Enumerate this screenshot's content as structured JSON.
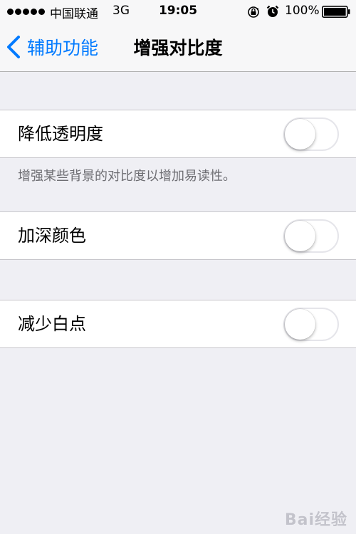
{
  "status_bar": {
    "carrier": "中国联通",
    "network": "3G",
    "time": "19:05",
    "battery_percent": "100%"
  },
  "nav": {
    "back_label": "辅助功能",
    "title": "增强对比度"
  },
  "settings": [
    {
      "label": "降低透明度",
      "on": false
    },
    {
      "label": "加深颜色",
      "on": false
    },
    {
      "label": "减少白点",
      "on": false
    }
  ],
  "footer_note": "增强某些背景的对比度以增加易读性。",
  "watermark": "Bai经验",
  "colors": {
    "accent": "#007aff",
    "background": "#efeff4",
    "toggle_border": "#e5e5ea"
  }
}
